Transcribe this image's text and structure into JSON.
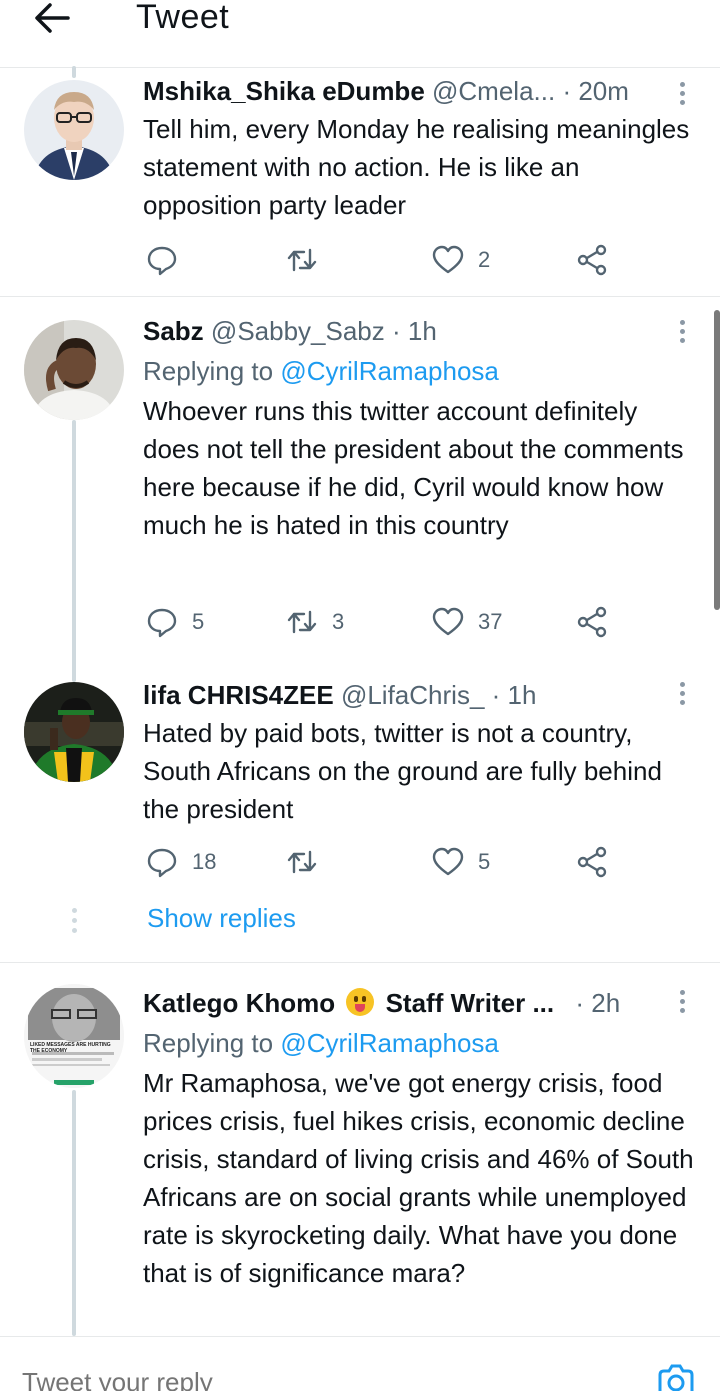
{
  "header": {
    "title": "Tweet"
  },
  "tweets": [
    {
      "name": "Mshika_Shika eDumbe",
      "handle": "@Cmela...",
      "time": "· 20m",
      "body": "Tell him, every Monday he realising meaningles statement with no action. He is like an opposition party leader",
      "replies": "",
      "retweets": "",
      "likes": "2"
    },
    {
      "name": "Sabz",
      "handle": "@Sabby_Sabz",
      "time": "· 1h",
      "reply_prefix": "Replying to",
      "reply_to": "@CyrilRamaphosa",
      "body": "Whoever runs this twitter account definitely does not tell the president about the comments here because if he did, Cyril would know how much he is hated in this country",
      "replies": "5",
      "retweets": "3",
      "likes": "37"
    },
    {
      "name": "lifa CHRIS4ZEE",
      "handle": "@LifaChris_",
      "time": "· 1h",
      "body": "Hated by paid bots, twitter is not a country, South Africans on the ground are fully behind the president",
      "replies": "18",
      "retweets": "",
      "likes": "5"
    },
    {
      "name": "Katlego Khomo",
      "name_suffix": "Staff Writer ...",
      "emoji": "tongue-out-emoji",
      "time": "· 2h",
      "reply_prefix": "Replying to",
      "reply_to": "@CyrilRamaphosa",
      "body": "Mr Ramaphosa, we've got energy crisis, food prices crisis, fuel hikes crisis, economic decline crisis, standard of living crisis and 46% of South Africans are on social grants while unemployed rate is skyrocketing daily. What have you done that is of significance mara?",
      "avatar_text": "LIKED MESSAGES ARE HURTING THE ECONOMY"
    }
  ],
  "show_replies": "Show replies",
  "reply_bar": {
    "placeholder": "Tweet your reply"
  },
  "colors": {
    "accent": "#1d9bf0",
    "secondary_text": "#536471",
    "thread_line": "#cfd9de"
  }
}
